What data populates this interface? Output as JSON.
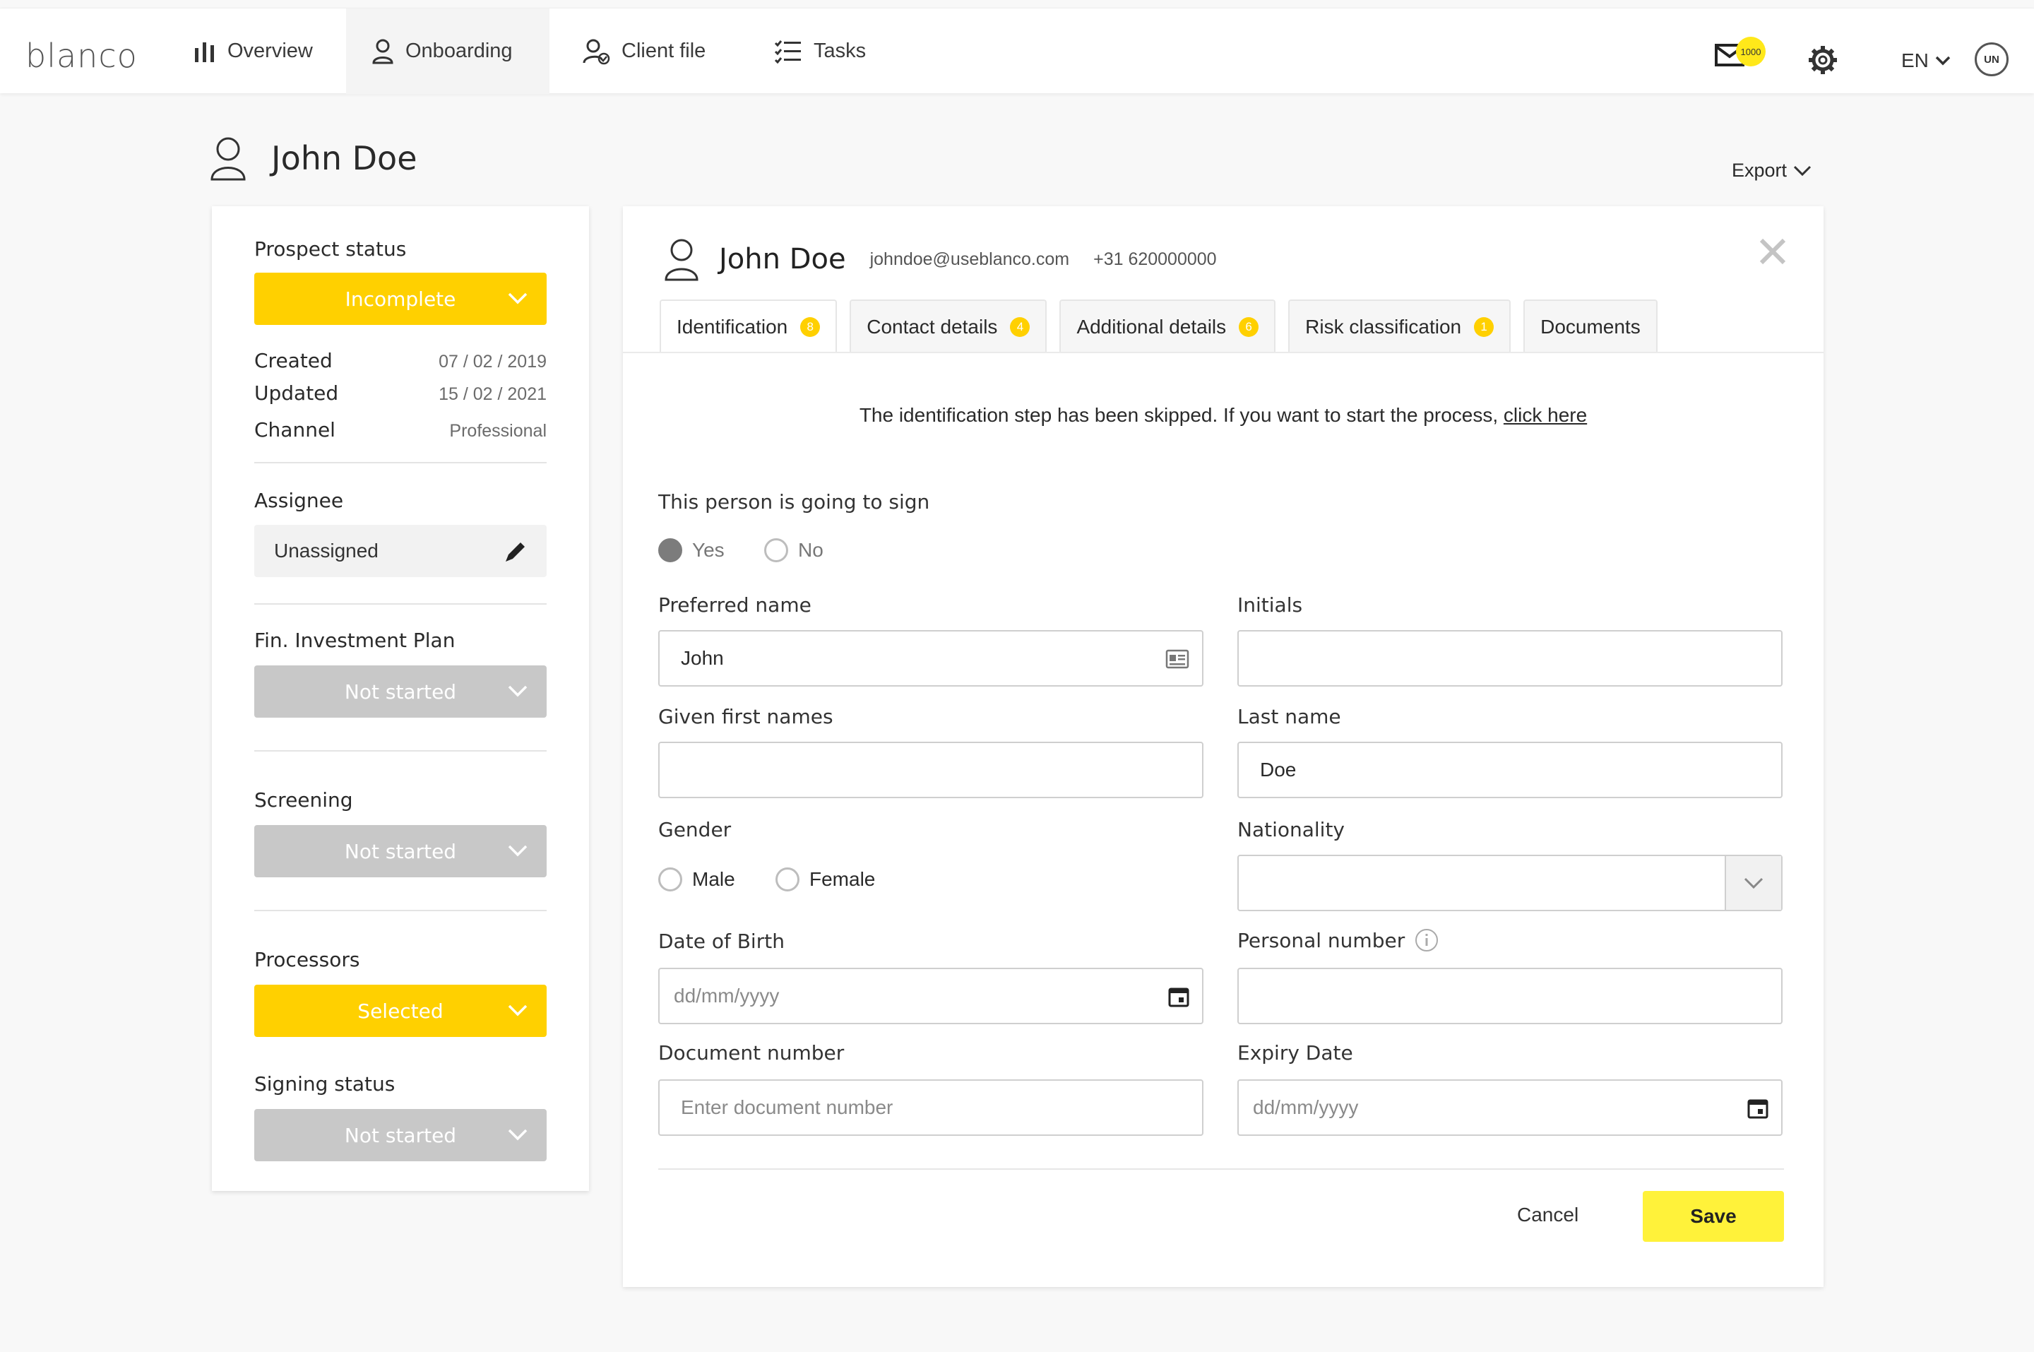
{
  "app": {
    "logo": "blanco"
  },
  "nav": {
    "overview": "Overview",
    "onboarding": "Onboarding",
    "client_file": "Client file",
    "tasks": "Tasks"
  },
  "header_right": {
    "mail_count": "1000",
    "language": "EN",
    "user_initials": "UN"
  },
  "page": {
    "title": "John Doe",
    "export_label": "Export"
  },
  "sidebar": {
    "prospect_status_label": "Prospect status",
    "prospect_status_value": "Incomplete",
    "created_label": "Created",
    "created_value": "07 / 02 / 2019",
    "updated_label": "Updated",
    "updated_value": "15 / 02 / 2021",
    "channel_label": "Channel",
    "channel_value": "Professional",
    "assignee_label": "Assignee",
    "assignee_value": "Unassigned",
    "fip_label": "Fin. Investment Plan",
    "fip_value": "Not started",
    "screening_label": "Screening",
    "screening_value": "Not started",
    "processors_label": "Processors",
    "processors_value": "Selected",
    "signing_label": "Signing status",
    "signing_value": "Not started"
  },
  "panel": {
    "name": "John Doe",
    "email": "johndoe@useblanco.com",
    "phone": "+31 620000000",
    "tabs": [
      {
        "label": "Identification",
        "badge": "8"
      },
      {
        "label": "Contact details",
        "badge": "4"
      },
      {
        "label": "Additional details",
        "badge": "6"
      },
      {
        "label": "Risk classification",
        "badge": "1"
      },
      {
        "label": "Documents",
        "badge": ""
      }
    ],
    "notice_text": "The identification step has been skipped. If you want to start the process,",
    "notice_link": "click here",
    "sign_question": "This person is going to sign",
    "sign_yes": "Yes",
    "sign_no": "No",
    "preferred_name_label": "Preferred name",
    "preferred_name_value": "John",
    "initials_label": "Initials",
    "initials_value": "",
    "given_names_label": "Given first names",
    "given_names_value": "",
    "last_name_label": "Last name",
    "last_name_value": "Doe",
    "gender_label": "Gender",
    "gender_male": "Male",
    "gender_female": "Female",
    "nationality_label": "Nationality",
    "nationality_value": "",
    "dob_label": "Date of Birth",
    "dob_placeholder": "dd/mm/yyyy",
    "personal_number_label": "Personal number",
    "personal_number_value": "",
    "document_number_label": "Document number",
    "document_number_placeholder": "Enter document number",
    "expiry_label": "Expiry Date",
    "expiry_placeholder": "dd/mm/yyyy",
    "cancel_label": "Cancel",
    "save_label": "Save"
  },
  "colors": {
    "accent_yellow": "#ffd000",
    "save_yellow": "#fff23a",
    "disabled_grey": "#c8c8c8"
  }
}
